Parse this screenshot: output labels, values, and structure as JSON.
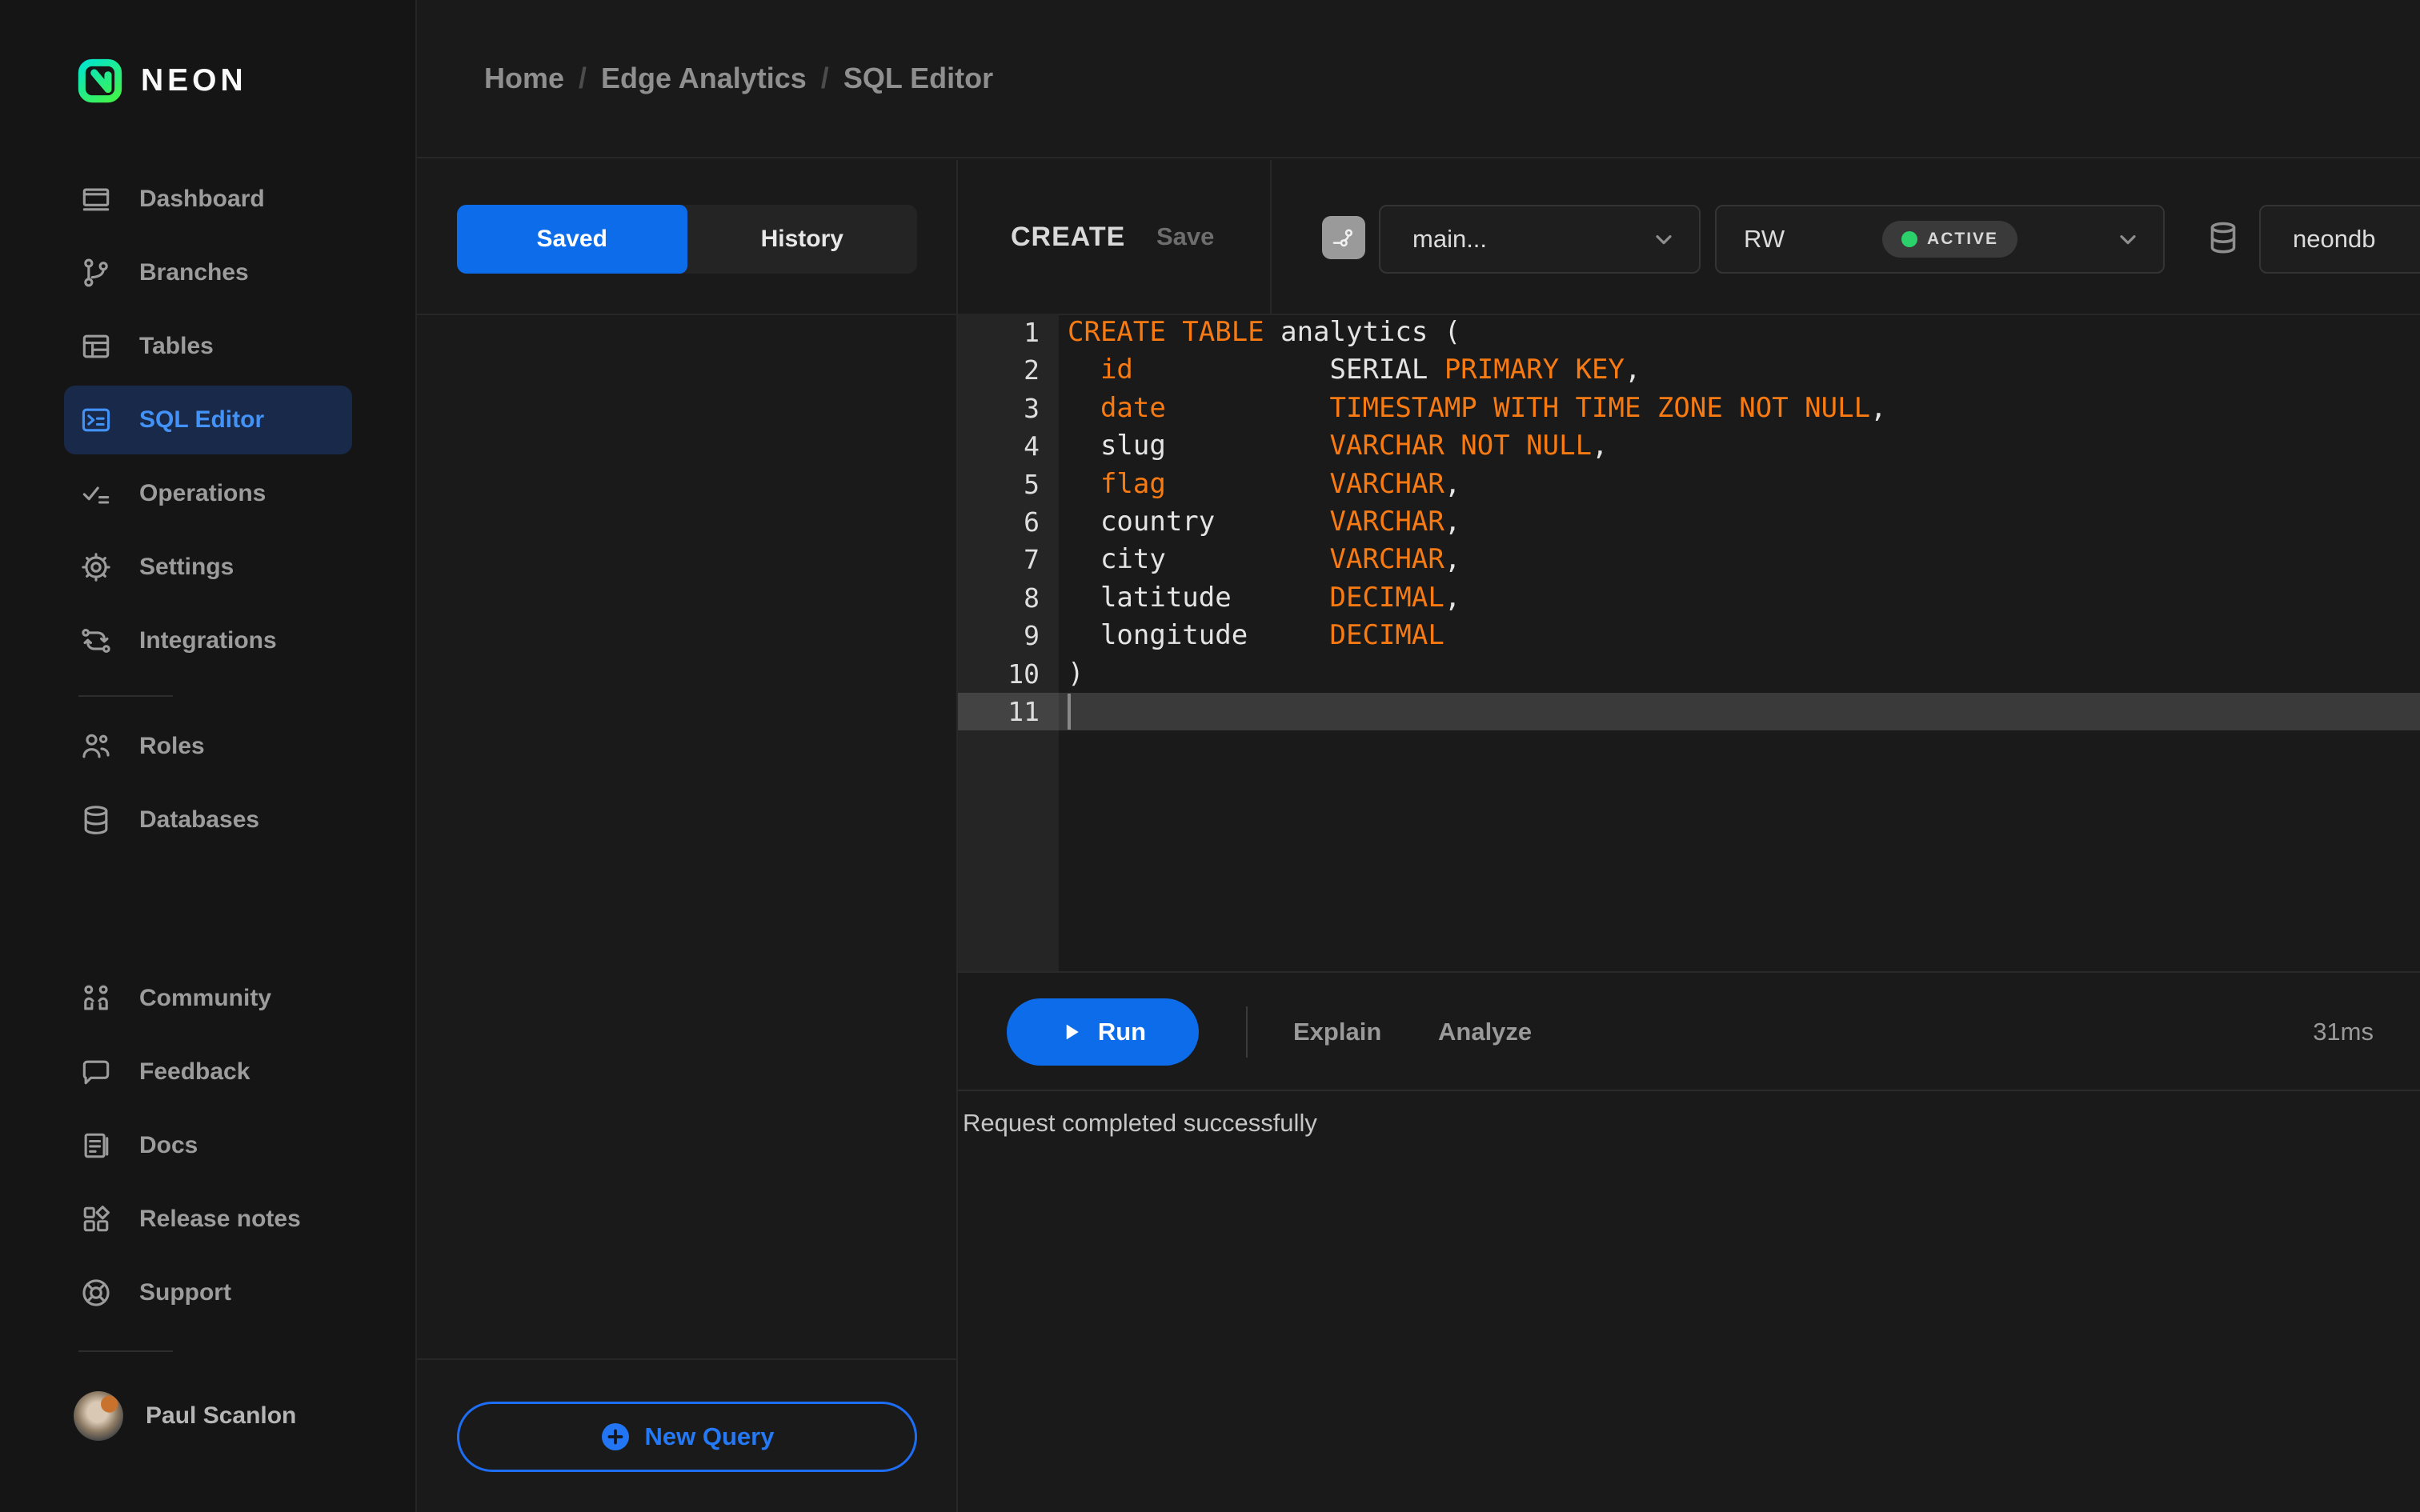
{
  "brand": {
    "name": "NEON"
  },
  "breadcrumb": {
    "separator": "/",
    "items": [
      "Home",
      "Edge Analytics",
      "SQL Editor"
    ]
  },
  "sidebar": {
    "primary": [
      {
        "label": "Dashboard"
      },
      {
        "label": "Branches"
      },
      {
        "label": "Tables"
      },
      {
        "label": "SQL Editor",
        "active": true
      },
      {
        "label": "Operations"
      },
      {
        "label": "Settings"
      },
      {
        "label": "Integrations"
      }
    ],
    "secondary": [
      {
        "label": "Roles"
      },
      {
        "label": "Databases"
      }
    ],
    "tertiary": [
      {
        "label": "Community"
      },
      {
        "label": "Feedback"
      },
      {
        "label": "Docs"
      },
      {
        "label": "Release notes"
      },
      {
        "label": "Support"
      }
    ],
    "user": {
      "name": "Paul Scanlon"
    }
  },
  "queries_panel": {
    "tabs": [
      {
        "label": "Saved",
        "active": true
      },
      {
        "label": "History",
        "active": false
      }
    ],
    "new_query_label": "New Query"
  },
  "editor": {
    "title": "CREATE",
    "save_label": "Save",
    "branch_select": {
      "value": "main..."
    },
    "endpoint_select": {
      "value": "RW",
      "status": "ACTIVE"
    },
    "database_select": {
      "value": "neondb"
    },
    "run_label": "Run",
    "explain_label": "Explain",
    "analyze_label": "Analyze",
    "duration": "31ms",
    "result_message": "Request completed successfully",
    "code_lines": [
      {
        "n": "1",
        "tokens": [
          {
            "t": "CREATE TABLE",
            "c": "kw"
          },
          {
            "t": " analytics (",
            "c": "pl"
          }
        ]
      },
      {
        "n": "2",
        "tokens": [
          {
            "t": "  id",
            "c": "kw"
          },
          {
            "t": "            SERIAL ",
            "c": "pl"
          },
          {
            "t": "PRIMARY KEY",
            "c": "kw"
          },
          {
            "t": ",",
            "c": "pl"
          }
        ]
      },
      {
        "n": "3",
        "tokens": [
          {
            "t": "  date",
            "c": "kw"
          },
          {
            "t": "          ",
            "c": "pl"
          },
          {
            "t": "TIMESTAMP WITH TIME ZONE NOT NULL",
            "c": "kw"
          },
          {
            "t": ",",
            "c": "pl"
          }
        ]
      },
      {
        "n": "4",
        "tokens": [
          {
            "t": "  slug",
            "c": "pl"
          },
          {
            "t": "          ",
            "c": "pl"
          },
          {
            "t": "VARCHAR NOT NULL",
            "c": "kw"
          },
          {
            "t": ",",
            "c": "pl"
          }
        ]
      },
      {
        "n": "5",
        "tokens": [
          {
            "t": "  flag",
            "c": "kw"
          },
          {
            "t": "          ",
            "c": "pl"
          },
          {
            "t": "VARCHAR",
            "c": "kw"
          },
          {
            "t": ",",
            "c": "pl"
          }
        ]
      },
      {
        "n": "6",
        "tokens": [
          {
            "t": "  country",
            "c": "pl"
          },
          {
            "t": "       ",
            "c": "pl"
          },
          {
            "t": "VARCHAR",
            "c": "kw"
          },
          {
            "t": ",",
            "c": "pl"
          }
        ]
      },
      {
        "n": "7",
        "tokens": [
          {
            "t": "  city",
            "c": "pl"
          },
          {
            "t": "          ",
            "c": "pl"
          },
          {
            "t": "VARCHAR",
            "c": "kw"
          },
          {
            "t": ",",
            "c": "pl"
          }
        ]
      },
      {
        "n": "8",
        "tokens": [
          {
            "t": "  latitude",
            "c": "pl"
          },
          {
            "t": "      ",
            "c": "pl"
          },
          {
            "t": "DECIMAL",
            "c": "kw"
          },
          {
            "t": ",",
            "c": "pl"
          }
        ]
      },
      {
        "n": "9",
        "tokens": [
          {
            "t": "  longitude",
            "c": "pl"
          },
          {
            "t": "     ",
            "c": "pl"
          },
          {
            "t": "DECIMAL",
            "c": "kw"
          }
        ]
      },
      {
        "n": "10",
        "tokens": [
          {
            "t": ")",
            "c": "pl"
          }
        ]
      },
      {
        "n": "11",
        "tokens": [],
        "active": true
      }
    ]
  },
  "colors": {
    "accent_blue": "#0d6cea",
    "link_blue": "#2579f4",
    "keyword_orange": "#f87a12",
    "status_green": "#2bd16a",
    "panel_bg": "#1a1a1a",
    "sidebar_bg": "#151515"
  }
}
